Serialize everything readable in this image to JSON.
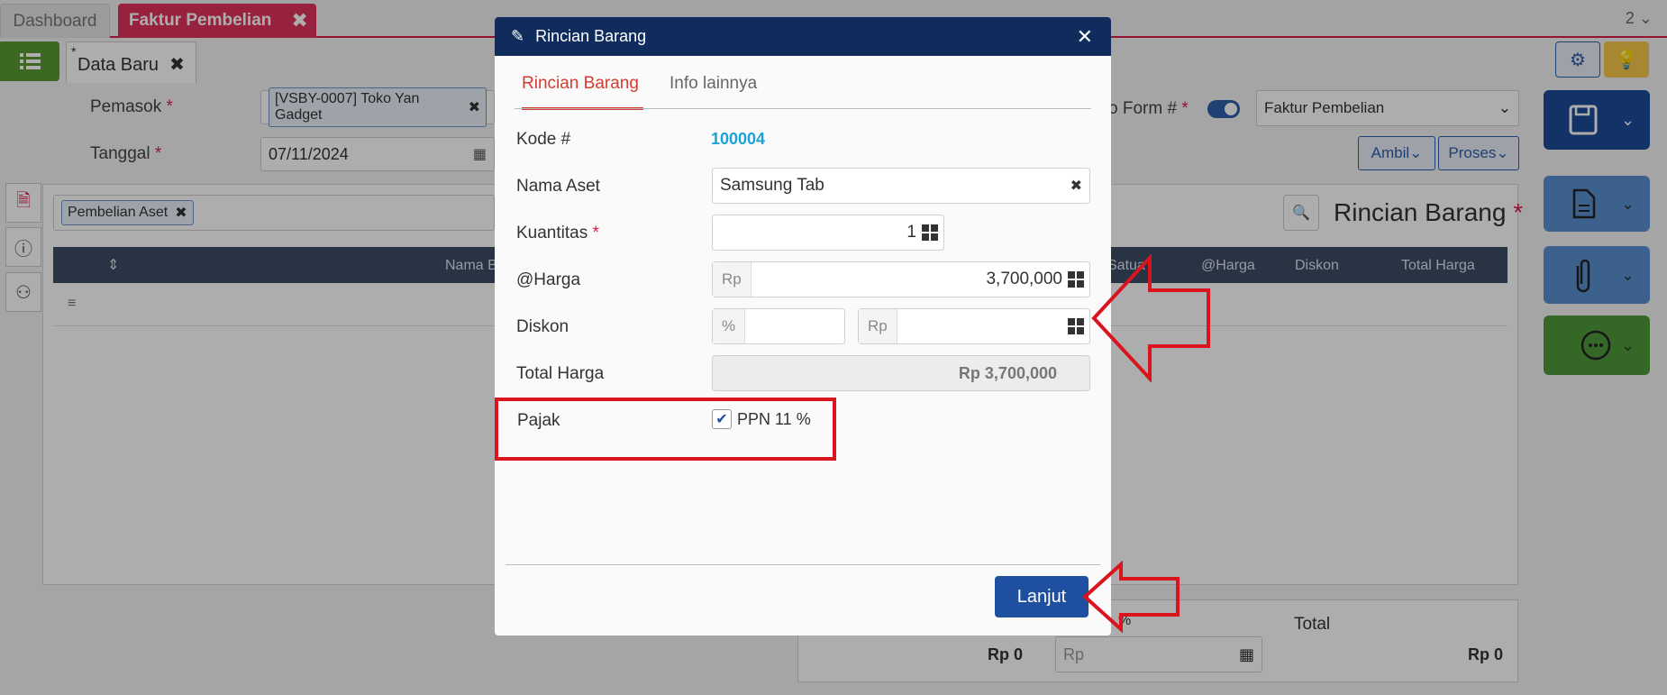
{
  "tabs": {
    "dashboard": "Dashboard",
    "faktur": "Faktur Pembelian",
    "page_count": "2"
  },
  "doc_tab": {
    "star": "*",
    "label": "Data Baru"
  },
  "form": {
    "pemasok_label": "Pemasok",
    "pemasok_value": "[VSBY-0007] Toko Yan Gadget",
    "tanggal_label": "Tanggal",
    "tanggal_value": "07/11/2024",
    "no_form_label": "o Form #",
    "form_type": "Faktur Pembelian",
    "required_mark": "*"
  },
  "buttons": {
    "ambil": "Ambil",
    "proses": "Proses"
  },
  "filter_chip": "Pembelian Aset",
  "section_title": "Rincian Barang",
  "table_headers": [
    "Nama B",
    "Satua",
    "@Harga",
    "Diskon",
    "Total Harga"
  ],
  "bottom": {
    "subtotal": "Rp 0",
    "pct": "%",
    "rp_placeholder": "Rp",
    "total_label": "Total",
    "total_value": "Rp 0"
  },
  "modal": {
    "title": "Rincian Barang",
    "tab_active": "Rincian Barang",
    "tab_other": "Info lainnya",
    "kode_label": "Kode #",
    "kode_value": "100004",
    "nama_label": "Nama Aset",
    "nama_value": "Samsung Tab",
    "qty_label": "Kuantitas",
    "qty_value": "1",
    "harga_label": "@Harga",
    "harga_prefix": "Rp",
    "harga_value": "3,700,000",
    "diskon_label": "Diskon",
    "diskon_pct_prefix": "%",
    "diskon_rp_prefix": "Rp",
    "total_label": "Total Harga",
    "total_value": "Rp 3,700,000",
    "pajak_label": "Pajak",
    "pajak_option": "PPN 11 %",
    "pajak_checked": true,
    "next_button": "Lanjut"
  },
  "colors": {
    "accent_red": "#d9204a",
    "modal_header": "#0f2c5c",
    "link_blue": "#1aa3d9",
    "primary_button": "#1e4fa0",
    "annotation_red": "#d9141f"
  }
}
